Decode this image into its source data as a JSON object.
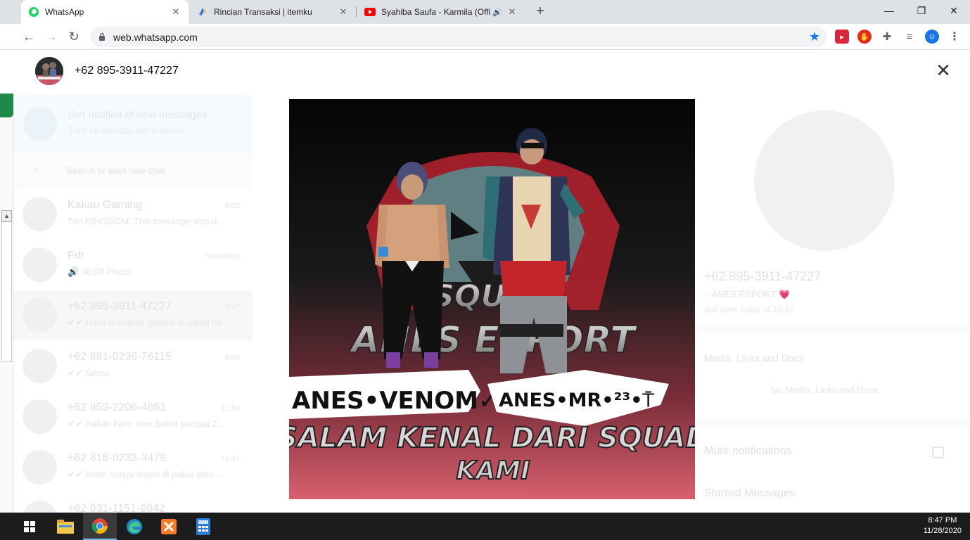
{
  "browser": {
    "tabs": [
      {
        "title": "WhatsApp",
        "active": true,
        "favicon": "whatsapp-icon"
      },
      {
        "title": "Rincian Transaksi | itemku",
        "active": false,
        "favicon": "itemku-icon"
      },
      {
        "title": "Syahiba Saufa - Karmila (Offi",
        "active": false,
        "favicon": "youtube-icon",
        "audio": true
      }
    ],
    "url": "web.whatsapp.com",
    "window_controls": {
      "minimize": "—",
      "restore": "❐",
      "close": "✕"
    }
  },
  "viewer": {
    "contact": "+62 895-3911-47227",
    "close_label": "✕",
    "image_texts": {
      "banner_top": "SQUAD",
      "banner_mid": "ANES ESPORT",
      "player_left": "ANES•VENOM✓",
      "player_right": "ANES•MR•²³•⍑",
      "footer_line1": "SALAM KENAL DARI SQUAD",
      "footer_line2": "KAMI"
    }
  },
  "background": {
    "notification": {
      "title": "Get notified of new messages",
      "subtitle": "Turn on desktop notifications ›"
    },
    "search_placeholder": "Search or start new chat",
    "chats": [
      {
        "name": "Kakau Gaming",
        "time": "8:52",
        "message": "Tim KINGDOM: This message was d..."
      },
      {
        "name": "Fdr",
        "time": "Yesterday",
        "message": "🔊 00:09 Photo"
      },
      {
        "name": "+62 895-3911-47227",
        "time": "8:47",
        "message": "✔✔ Hasil di submit gemoh di pakai ha..."
      },
      {
        "name": "+62 881-0236-76115",
        "time": "8:45",
        "message": "✔✔ Semo"
      },
      {
        "name": "+62 853-2206-4861",
        "time": "11:54",
        "message": "✔✔ Kalian kami nnm bakal sampai 2..."
      },
      {
        "name": "+62 818-0233-3479",
        "time": "11:47",
        "message": "✔✔ Kode hanya dapat di pakai satu..."
      },
      {
        "name": "+62 831-1151-9842",
        "time": "",
        "message": ""
      }
    ],
    "info_panel": {
      "name": "+62 895-3911-47227",
      "about": "~ ANES ESPORT 💗",
      "last_seen": "last seen today at 19:47",
      "media_label": "Media, Links and Docs",
      "no_media": "No Media, Links and Docs",
      "mute_label": "Mute notifications",
      "starred_label": "Starred Messages"
    }
  },
  "taskbar": {
    "time": "8:47 PM",
    "date": "11/28/2020",
    "apps": [
      "windows-start-icon",
      "file-explorer-icon",
      "chrome-icon",
      "edge-icon",
      "xampp-icon",
      "calculator-icon"
    ]
  }
}
